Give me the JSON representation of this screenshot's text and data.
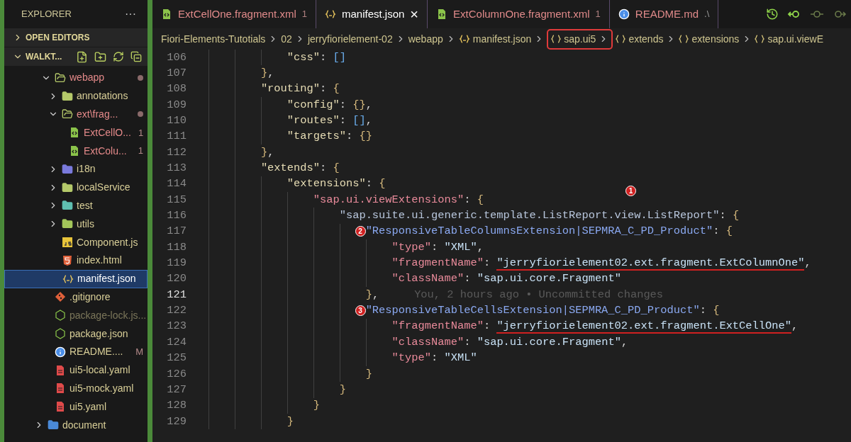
{
  "sidebar": {
    "title": "EXPLORER",
    "more": "···",
    "sections": [
      {
        "label": "OPEN EDITORS",
        "expanded": false
      },
      {
        "label": "WALKT...",
        "expanded": true
      }
    ],
    "tree": [
      {
        "name": "webapp",
        "kind": "folder",
        "expanded": true,
        "error": true,
        "ignored": false,
        "modified": true,
        "selected": false,
        "children": [
          {
            "name": "annotations",
            "kind": "folder",
            "expanded": false,
            "error": false,
            "ignored": false,
            "modified": false,
            "selected": false
          },
          {
            "name": "ext\\frag...",
            "kind": "folder",
            "expanded": true,
            "error": true,
            "ignored": false,
            "modified": true,
            "selected": false,
            "children": [
              {
                "name": "ExtCellO...",
                "kind": "xml",
                "badge": "1",
                "error": true,
                "ignored": false,
                "modified": false,
                "selected": false
              },
              {
                "name": "ExtColu...",
                "kind": "xml",
                "badge": "1",
                "error": true,
                "ignored": false,
                "modified": false,
                "selected": false
              }
            ]
          },
          {
            "name": "i18n",
            "kind": "folder-i18n",
            "expanded": false,
            "error": false,
            "ignored": false,
            "modified": false,
            "selected": false
          },
          {
            "name": "localService",
            "kind": "folder",
            "expanded": false,
            "error": false,
            "ignored": false,
            "modified": false,
            "selected": false
          },
          {
            "name": "test",
            "kind": "folder-test",
            "expanded": false,
            "error": false,
            "ignored": false,
            "modified": false,
            "selected": false
          },
          {
            "name": "utils",
            "kind": "folder-utils",
            "expanded": false,
            "error": false,
            "ignored": false,
            "modified": false,
            "selected": false
          },
          {
            "name": "Component.js",
            "kind": "js",
            "error": false,
            "ignored": false,
            "modified": false,
            "selected": false
          },
          {
            "name": "index.html",
            "kind": "html",
            "error": false,
            "ignored": false,
            "modified": false,
            "selected": false
          },
          {
            "name": "manifest.json",
            "kind": "json",
            "error": false,
            "ignored": false,
            "modified": false,
            "selected": true
          }
        ]
      },
      {
        "name": ".gitignore",
        "kind": "git",
        "error": false,
        "ignored": false,
        "modified": false,
        "selected": false
      },
      {
        "name": "package-lock.js...",
        "kind": "node",
        "error": false,
        "ignored": true,
        "modified": false,
        "selected": false
      },
      {
        "name": "package.json",
        "kind": "node",
        "error": false,
        "ignored": false,
        "modified": false,
        "selected": false
      },
      {
        "name": "README....",
        "kind": "info",
        "badge": "M",
        "error": false,
        "ignored": false,
        "modified": false,
        "selected": false
      },
      {
        "name": "ui5-local.yaml",
        "kind": "yaml",
        "error": false,
        "ignored": false,
        "modified": false,
        "selected": false
      },
      {
        "name": "ui5-mock.yaml",
        "kind": "yaml",
        "error": false,
        "ignored": false,
        "modified": false,
        "selected": false
      },
      {
        "name": "ui5.yaml",
        "kind": "yaml",
        "error": false,
        "ignored": false,
        "modified": false,
        "selected": false
      }
    ],
    "outer_tree": [
      {
        "name": "document",
        "kind": "folder-doc",
        "expanded": false,
        "error": false,
        "ignored": false,
        "modified": false,
        "selected": false
      }
    ]
  },
  "tabs": [
    {
      "label": "ExtCellOne.fragment.xml",
      "kind": "xml",
      "badge": "1",
      "selected": false
    },
    {
      "label": "manifest.json",
      "kind": "json",
      "close": "×",
      "selected": true
    },
    {
      "label": "ExtColumnOne.fragment.xml",
      "kind": "xml",
      "badge": "1",
      "selected": false
    },
    {
      "label": "README.md",
      "kind": "info",
      "path": ".\\",
      "selected": false
    }
  ],
  "breadcrumbs": [
    {
      "label": "Fiori-Elements-Tutotials",
      "kind": "folder",
      "highlighted": false
    },
    {
      "label": "02",
      "kind": "folder",
      "highlighted": false
    },
    {
      "label": "jerryfiorielement-02",
      "kind": "folder",
      "highlighted": false
    },
    {
      "label": "webapp",
      "kind": "folder",
      "highlighted": false
    },
    {
      "label": "manifest.json",
      "kind": "json",
      "highlighted": false
    },
    {
      "label": "sap.ui5",
      "kind": "object",
      "highlighted": true
    },
    {
      "label": "extends",
      "kind": "object",
      "highlighted": false
    },
    {
      "label": "extensions",
      "kind": "object",
      "highlighted": false
    },
    {
      "label": "sap.ui.viewE",
      "kind": "object",
      "highlighted": false
    }
  ],
  "editor": {
    "lines": [
      {
        "number": "106",
        "code": "            \"css\": []"
      },
      {
        "number": "107",
        "code": "        },"
      },
      {
        "number": "108",
        "code": "        \"routing\": {"
      },
      {
        "number": "109",
        "code": "            \"config\": {},"
      },
      {
        "number": "110",
        "code": "            \"routes\": [],"
      },
      {
        "number": "111",
        "code": "            \"targets\": {}"
      },
      {
        "number": "112",
        "code": "        },"
      },
      {
        "number": "113",
        "code": "        \"extends\": {"
      },
      {
        "number": "114",
        "code": "            \"extensions\": {"
      },
      {
        "number": "115",
        "code": "                \"sap.ui.viewExtensions\": {",
        "marker": "1",
        "kind": "floating-marker"
      },
      {
        "number": "116",
        "code": "                    \"sap.suite.ui.generic.template.ListReport.view.ListReport\": {"
      },
      {
        "number": "117",
        "code": "                        \"ResponsiveTableColumnsExtension|SEPMRA_C_PD_Product\": {",
        "marker": "2",
        "kind": "inline-marker"
      },
      {
        "number": "118",
        "code": "                            \"type\": \"XML\","
      },
      {
        "number": "119",
        "code": "                            \"fragmentName\": \"jerryfiorielement02.ext.fragment.ExtColumnOne\",",
        "underlined": true
      },
      {
        "number": "120",
        "code": "                            \"className\": \"sap.ui.core.Fragment\""
      },
      {
        "number": "121",
        "code": "                        },",
        "current": true,
        "blame": "You, 2 hours ago • Uncommitted changes"
      },
      {
        "number": "122",
        "code": "                        \"ResponsiveTableCellsExtension|SEPMRA_C_PD_Product\": {",
        "marker": "3",
        "kind": "inline-marker"
      },
      {
        "number": "123",
        "code": "                            \"fragmentName\": \"jerryfiorielement02.ext.fragment.ExtCellOne\",",
        "underlined": true
      },
      {
        "number": "124",
        "code": "                            \"className\": \"sap.ui.core.Fragment\","
      },
      {
        "number": "125",
        "code": "                            \"type\": \"XML\""
      },
      {
        "number": "126",
        "code": "                        }"
      },
      {
        "number": "127",
        "code": "                    }"
      },
      {
        "number": "128",
        "code": "                }"
      },
      {
        "number": "129",
        "code": "            }"
      }
    ]
  }
}
